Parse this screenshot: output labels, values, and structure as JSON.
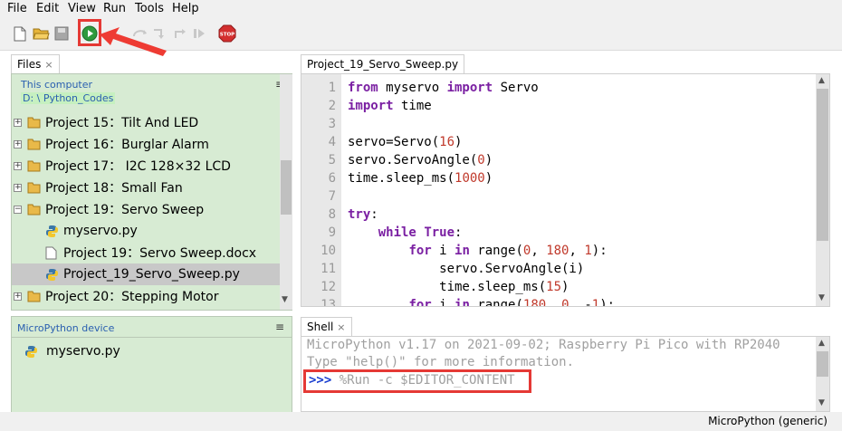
{
  "menu": [
    "File",
    "Edit",
    "View",
    "Run",
    "Tools",
    "Help"
  ],
  "toolbar": {
    "icons": [
      "new-file-icon",
      "open-folder-icon",
      "save-icon",
      "run-icon",
      "debug-icon",
      "step-over-icon",
      "step-into-icon",
      "step-out-icon",
      "resume-icon",
      "stop-icon"
    ],
    "stop_label": "STOP"
  },
  "files": {
    "tab_label": "Files",
    "computer_title": "This computer",
    "computer_path": "D: \\ Python_Codes",
    "tree": [
      {
        "label": "Project 15：Tilt And LED",
        "type": "folder",
        "expander": "+"
      },
      {
        "label": "Project 16：Burglar Alarm",
        "type": "folder",
        "expander": "+"
      },
      {
        "label": "Project 17： I2C 128×32 LCD",
        "type": "folder",
        "expander": "+"
      },
      {
        "label": "Project 18：Small Fan",
        "type": "folder",
        "expander": "+"
      },
      {
        "label": "Project 19：Servo Sweep",
        "type": "folder",
        "expander": "−"
      },
      {
        "label": "myservo.py",
        "type": "py",
        "indent": 1
      },
      {
        "label": "Project 19：Servo Sweep.docx",
        "type": "doc",
        "indent": 1
      },
      {
        "label": "Project_19_Servo_Sweep.py",
        "type": "py",
        "indent": 1,
        "selected": true
      },
      {
        "label": "Project 20：Stepping Motor",
        "type": "folder",
        "expander": "+"
      }
    ],
    "device_title": "MicroPython device",
    "device_files": [
      "myservo.py"
    ]
  },
  "editor": {
    "tab_label": "Project_19_Servo_Sweep.py",
    "line_numbers": [
      "1",
      "2",
      "3",
      "4",
      "5",
      "6",
      "7",
      "8",
      "9",
      "10",
      "11",
      "12",
      "13"
    ],
    "lines": [
      [
        {
          "t": "from",
          "k": "kw"
        },
        {
          "t": " myservo "
        },
        {
          "t": "import",
          "k": "kw"
        },
        {
          "t": " Servo"
        }
      ],
      [
        {
          "t": "import",
          "k": "kw"
        },
        {
          "t": " time"
        }
      ],
      [],
      [
        {
          "t": "servo=Servo("
        },
        {
          "t": "16",
          "k": "num"
        },
        {
          "t": ")"
        }
      ],
      [
        {
          "t": "servo.ServoAngle("
        },
        {
          "t": "0",
          "k": "num"
        },
        {
          "t": ")"
        }
      ],
      [
        {
          "t": "time.sleep_ms("
        },
        {
          "t": "1000",
          "k": "num"
        },
        {
          "t": ")"
        }
      ],
      [],
      [
        {
          "t": "try",
          "k": "kw"
        },
        {
          "t": ":"
        }
      ],
      [
        {
          "t": "    "
        },
        {
          "t": "while",
          "k": "kw"
        },
        {
          "t": " "
        },
        {
          "t": "True",
          "k": "kw"
        },
        {
          "t": ":"
        }
      ],
      [
        {
          "t": "        "
        },
        {
          "t": "for",
          "k": "kw"
        },
        {
          "t": " i "
        },
        {
          "t": "in",
          "k": "kw"
        },
        {
          "t": " range("
        },
        {
          "t": "0",
          "k": "num"
        },
        {
          "t": ", "
        },
        {
          "t": "180",
          "k": "num"
        },
        {
          "t": ", "
        },
        {
          "t": "1",
          "k": "num"
        },
        {
          "t": "):"
        }
      ],
      [
        {
          "t": "            servo.ServoAngle(i)"
        }
      ],
      [
        {
          "t": "            time.sleep_ms("
        },
        {
          "t": "15",
          "k": "num"
        },
        {
          "t": ")"
        }
      ],
      [
        {
          "t": "        "
        },
        {
          "t": "for",
          "k": "kw"
        },
        {
          "t": " i "
        },
        {
          "t": "in",
          "k": "kw"
        },
        {
          "t": " range("
        },
        {
          "t": "180",
          "k": "num"
        },
        {
          "t": ", "
        },
        {
          "t": "0",
          "k": "num"
        },
        {
          "t": ", -"
        },
        {
          "t": "1",
          "k": "num"
        },
        {
          "t": "):"
        }
      ]
    ]
  },
  "shell": {
    "tab_label": "Shell",
    "lines": [
      "MicroPython v1.17 on 2021-09-02; Raspberry Pi Pico with RP2040",
      "Type \"help()\" for more information."
    ],
    "prompt": ">>>",
    "command": " %Run -c $EDITOR_CONTENT"
  },
  "status": {
    "interpreter": "MicroPython (generic)"
  },
  "colors": {
    "panel_bg": "#d7ebd3",
    "highlight": "#e53935",
    "keyword": "#7a1fa2",
    "number": "#c0392b"
  }
}
